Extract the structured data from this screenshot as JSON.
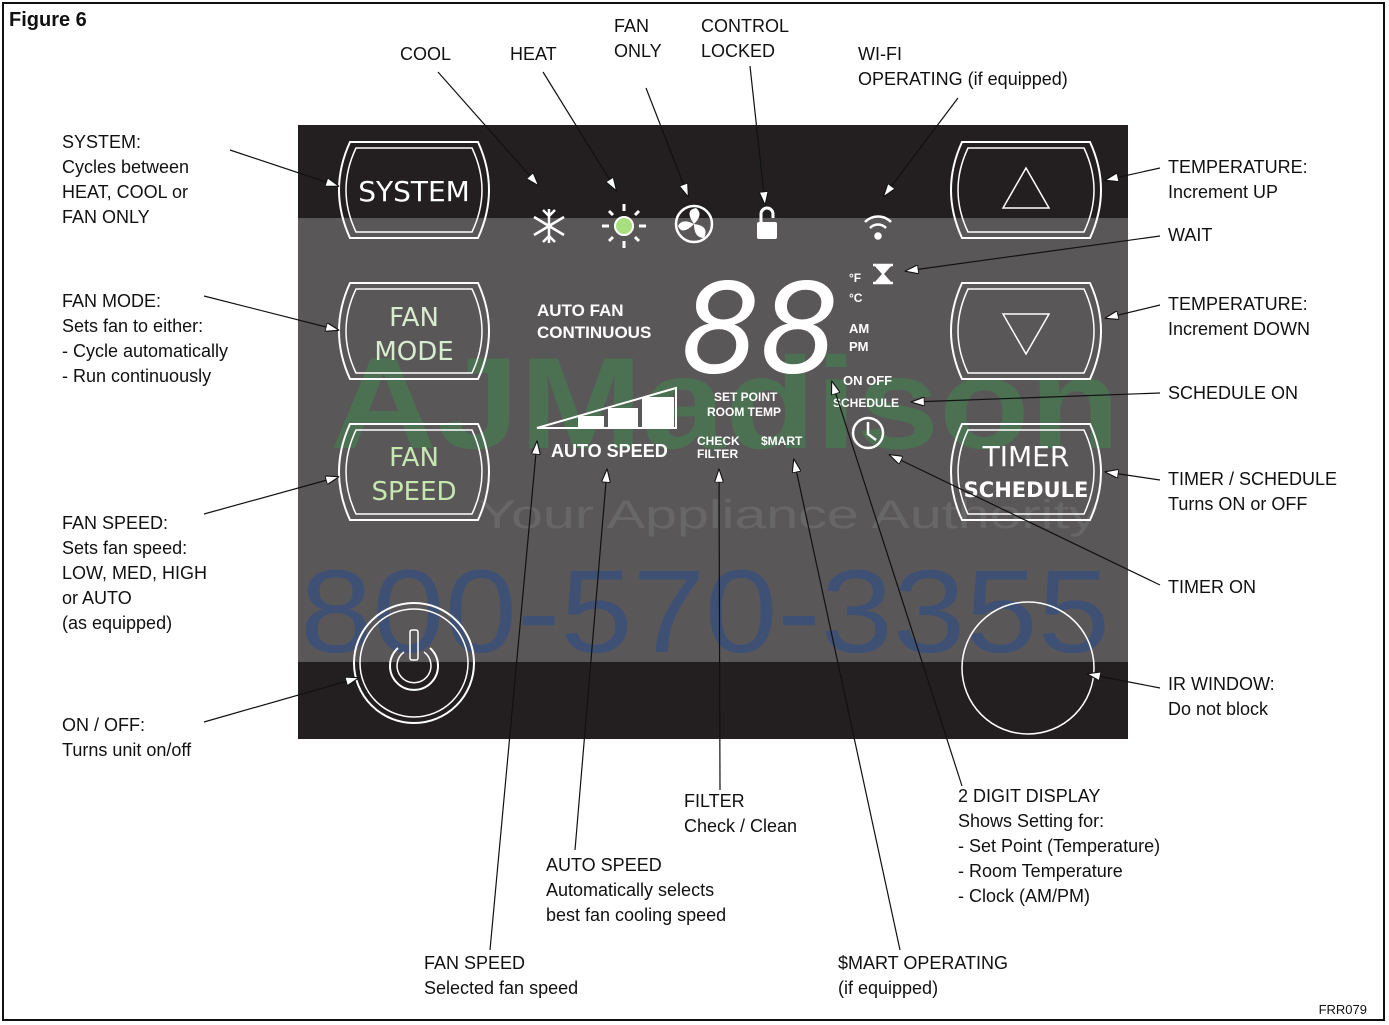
{
  "figure": {
    "title": "Figure 6",
    "code": "FRR079"
  },
  "buttons": {
    "system": "SYSTEM",
    "fan_mode": [
      "FAN",
      "MODE"
    ],
    "fan_speed": [
      "FAN",
      "SPEED"
    ],
    "timer": "TIMER",
    "schedule": "SCHEDULE"
  },
  "display": {
    "digits": "88",
    "unit_f": "°F",
    "unit_c": "°C",
    "am": "AM",
    "pm": "PM",
    "auto_fan": "AUTO FAN",
    "continuous": "CONTINUOUS",
    "set_point": "SET POINT",
    "room_temp": "ROOM TEMP",
    "on_off": "ON OFF",
    "schedule": "SCHEDULE",
    "auto_speed": "AUTO SPEED",
    "check": "CHECK",
    "filter": "FILTER",
    "smart": "$MART"
  },
  "watermark": {
    "brand": "AJMadison",
    "tagline": "Your Appliance Authority",
    "phone": "800-570-3355"
  },
  "callouts": {
    "cool": [
      "COOL"
    ],
    "heat": [
      "HEAT"
    ],
    "fan_only": [
      "FAN",
      "ONLY"
    ],
    "control_locked": [
      "CONTROL",
      "LOCKED"
    ],
    "wifi": [
      "WI-FI",
      "OPERATING (if equipped)"
    ],
    "system": [
      "SYSTEM:",
      "Cycles between",
      "HEAT, COOL or",
      "FAN ONLY"
    ],
    "fan_mode": [
      "FAN MODE:",
      "Sets fan to either:",
      "- Cycle automatically",
      "- Run continuously"
    ],
    "fan_speed": [
      "FAN SPEED:",
      "Sets fan speed:",
      "LOW, MED, HIGH",
      "or AUTO",
      "(as equipped)"
    ],
    "on_off": [
      "ON / OFF:",
      "Turns unit on/off"
    ],
    "temp_up": [
      "TEMPERATURE:",
      "Increment UP"
    ],
    "wait": [
      "WAIT"
    ],
    "temp_down": [
      "TEMPERATURE:",
      "Increment DOWN"
    ],
    "schedule_on": [
      "SCHEDULE ON"
    ],
    "timer_schedule": [
      "TIMER / SCHEDULE",
      "Turns ON or OFF"
    ],
    "timer_on": [
      "TIMER ON"
    ],
    "ir_window": [
      "IR WINDOW:",
      "Do not block"
    ],
    "filter": [
      "FILTER",
      "Check / Clean"
    ],
    "auto_speed": [
      "AUTO SPEED",
      "Automatically selects",
      "best fan cooling speed"
    ],
    "fan_speed_selected": [
      "FAN SPEED",
      "Selected fan speed"
    ],
    "two_digit": [
      "2 DIGIT DISPLAY",
      "Shows Setting for:",
      "- Set Point (Temperature)",
      "- Room Temperature",
      "- Clock (AM/PM)"
    ],
    "smart_operating": [
      "$MART OPERATING",
      "(if equipped)"
    ]
  },
  "colors": {
    "panel": "#231f20",
    "band": "#5a5758",
    "icon_green": "#a8e080",
    "button_text_green": "#c6e8b0",
    "watermark_green": "#3b8f4b",
    "watermark_blue": "#1e4a9a"
  },
  "icons": [
    "snowflake-icon",
    "sun-icon",
    "fan-icon",
    "lock-icon",
    "wifi-icon",
    "hourglass-icon",
    "clock-icon",
    "power-icon",
    "up-triangle-icon",
    "down-triangle-icon"
  ]
}
